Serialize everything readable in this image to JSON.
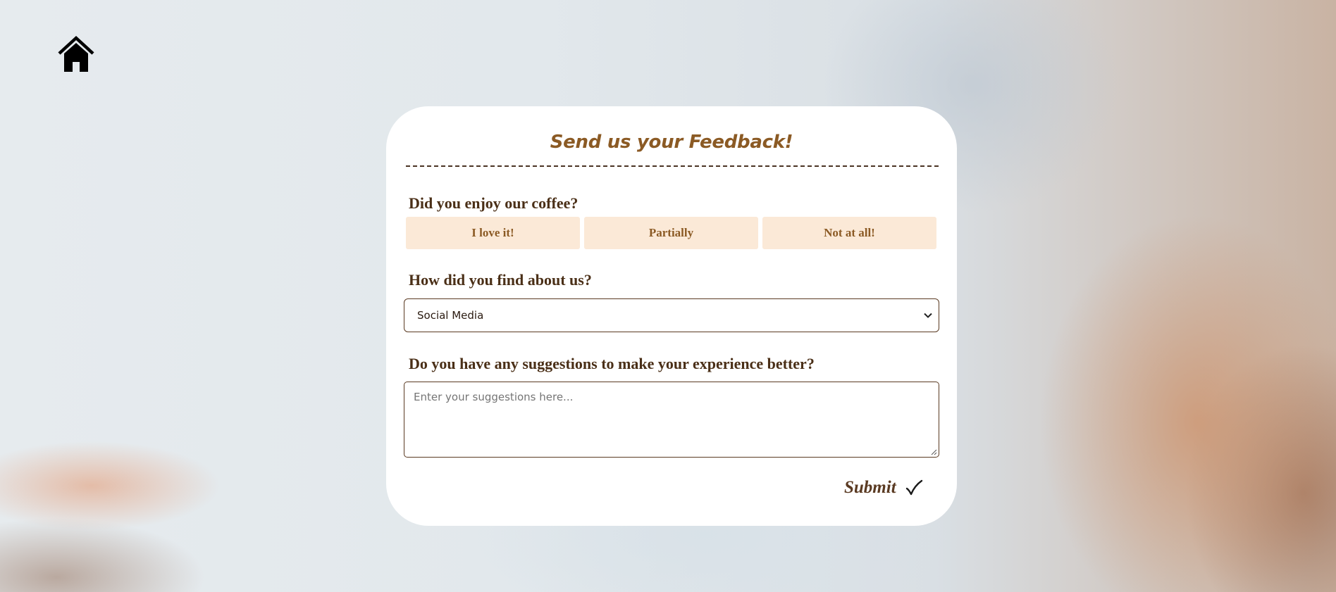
{
  "nav": {
    "home_icon": "home-icon"
  },
  "form": {
    "title": "Send us your Feedback!",
    "q1": {
      "label": "Did you enjoy our coffee?",
      "options": [
        "I love it!",
        "Partially",
        "Not at all!"
      ]
    },
    "q2": {
      "label": "How did you find about us?",
      "selected": "Social Media"
    },
    "q3": {
      "label": "Do you have any suggestions to make your experience better?",
      "placeholder": "Enter your suggestions here..."
    },
    "submit_label": "Submit",
    "submit_icon": "checkmark-icon"
  },
  "colors": {
    "accent": "#8b5a24",
    "text_dark": "#4a2f17",
    "choice_bg": "#fbe9d7",
    "card_bg": "#ffffff"
  }
}
